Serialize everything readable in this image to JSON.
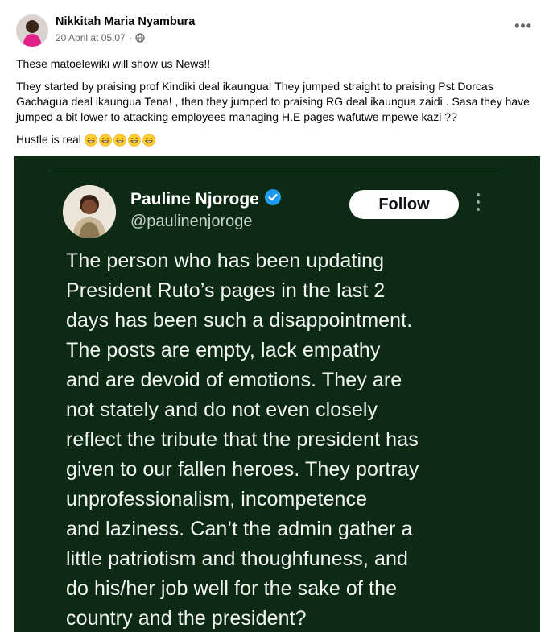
{
  "post": {
    "author": "Nikkitah Maria Nyambura",
    "timestamp": "20 April at 05:07",
    "privacy_icon": "globe-icon",
    "more_icon": "more-options-icon",
    "paragraphs": [
      "These matoelewiki will show us News!!",
      "They started by praising prof Kindiki deal ikaungua! They jumped straight to praising Pst Dorcas Gachagua deal ikaungua Tena! , then they jumped to praising RG deal ikaungua zaidi . Sasa they have jumped a bit lower to  attacking employees managing H.E pages wafutwe mpewe kazi ??"
    ],
    "closing_text": "Hustle is real",
    "emoji_count": 5
  },
  "tweet": {
    "name": "Pauline Njoroge",
    "handle": "@paulinenjoroge",
    "verified": true,
    "follow_label": "Follow",
    "text_lines": [
      "The person who has been updating",
      "President Ruto’s pages in the last 2",
      "days has been such a disappointment.",
      "The posts are empty, lack empathy",
      "and are devoid of emotions. They are",
      "not stately and do not even closely",
      "reflect the tribute that the president has",
      "given to our fallen heroes. They portray",
      "unprofessionalism, incompetence",
      "and laziness. Can’t the admin gather a",
      "little patriotism and thoughfuness, and",
      "do his/her job well for the sake of the",
      "country and the president?"
    ]
  },
  "colors": {
    "tweet_background": "#0d2a14",
    "verified_blue": "#1d9bf0",
    "meta_gray": "#65676b"
  }
}
